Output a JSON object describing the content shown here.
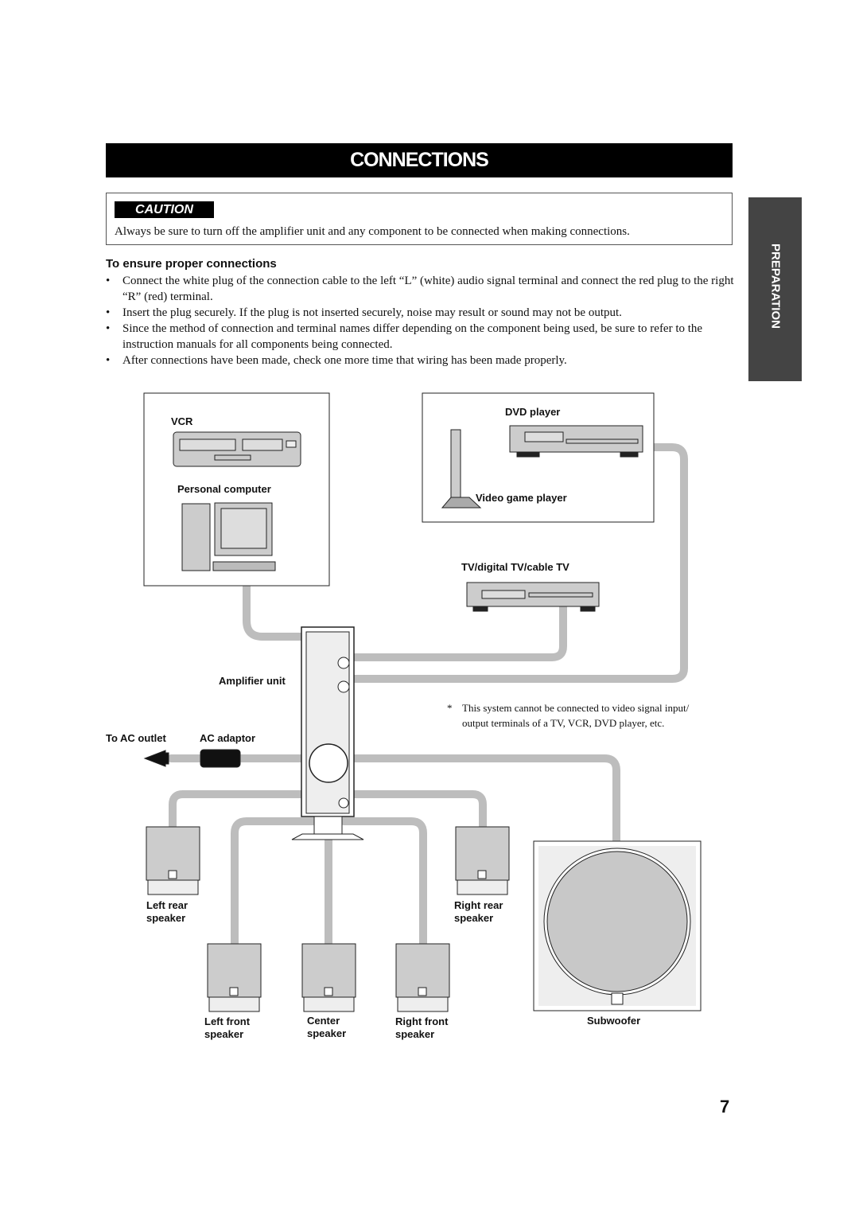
{
  "title": "CONNECTIONS",
  "caution": {
    "label": "CAUTION",
    "text": "Always be sure to turn off the amplifier unit and any component to be connected when making connections."
  },
  "section": {
    "heading": "To ensure proper connections",
    "bullets": [
      "Connect the white plug of the connection cable to the left “L” (white) audio signal terminal and connect the red plug to the right “R” (red) terminal.",
      "Insert the plug securely. If the plug is not inserted securely, noise may result or sound may not be output.",
      "Since the method of connection and terminal names differ depending on the component being used, be sure to refer to the instruction manuals for all components being connected.",
      "After connections have been made, check one more time that wiring has been made properly."
    ]
  },
  "side_tab": "PREPARATION",
  "diagram": {
    "vcr": "VCR",
    "pc": "Personal computer",
    "dvd": "DVD player",
    "game": "Video game player",
    "tv": "TV/digital TV/cable TV",
    "amp": "Amplifier unit",
    "ac_outlet": "To AC outlet",
    "ac_adaptor": "AC adaptor",
    "note_mark": "*",
    "note_line1": "This system cannot be connected to video signal input/",
    "note_line2": "output terminals of a TV, VCR, DVD player, etc.",
    "left_rear": [
      "Left rear",
      "speaker"
    ],
    "right_rear": [
      "Right rear",
      "speaker"
    ],
    "left_front": [
      "Left front",
      "speaker"
    ],
    "center": [
      "Center",
      "speaker"
    ],
    "right_front": [
      "Right front",
      "speaker"
    ],
    "subwoofer": "Subwoofer"
  },
  "page_number": "7"
}
